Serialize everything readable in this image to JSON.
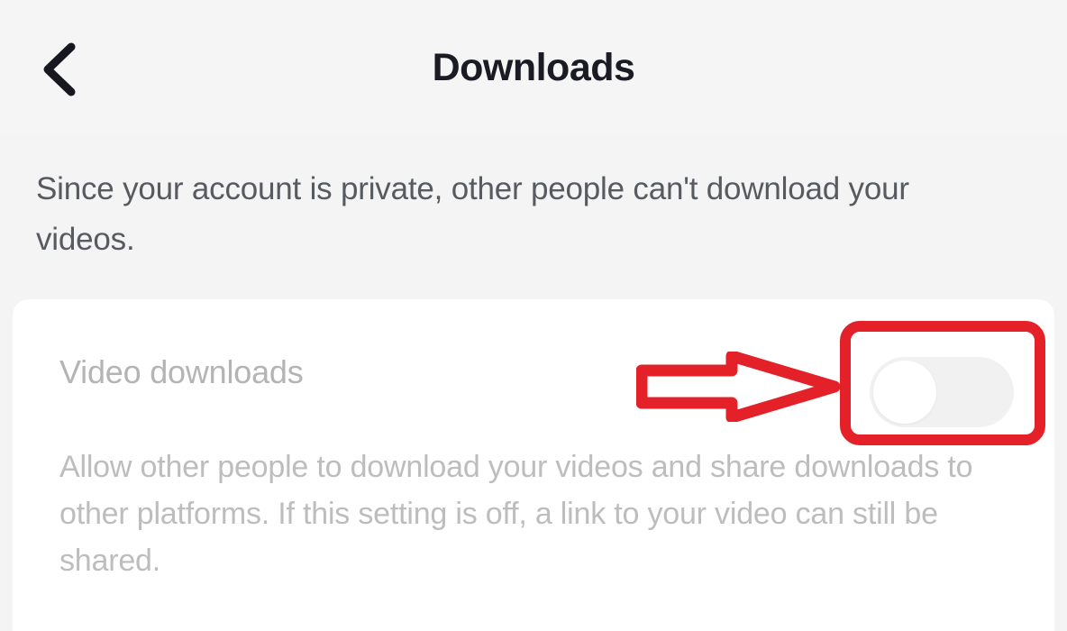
{
  "header": {
    "title": "Downloads",
    "back_icon": "chevron-left-icon"
  },
  "notice": {
    "text": "Since your account is private, other people can't download your videos."
  },
  "setting": {
    "label": "Video downloads",
    "description": "Allow other people to download your videos and share downloads to other platforms. If this setting is off, a link to your video can still be shared.",
    "toggle": {
      "name": "video-downloads-toggle",
      "state": "off",
      "knob_position": "left",
      "track_color": "#f1f1f1",
      "knob_color": "#ffffff"
    }
  },
  "annotations": {
    "highlight_box": {
      "shape": "rounded-rectangle",
      "color": "#e42029",
      "stroke_width": 12,
      "target": "video-downloads-toggle"
    },
    "arrow": {
      "shape": "outlined-block-arrow",
      "direction": "right",
      "color": "#e42029",
      "fill": "#ffffff",
      "target": "video-downloads-toggle"
    }
  },
  "colors": {
    "background": "#f4f4f4",
    "card": "#ffffff",
    "title_text": "#1b1b24",
    "notice_text": "#575b60",
    "label_text": "#b4b4b4",
    "description_text": "#bdbdbd",
    "accent_red": "#e42029"
  }
}
